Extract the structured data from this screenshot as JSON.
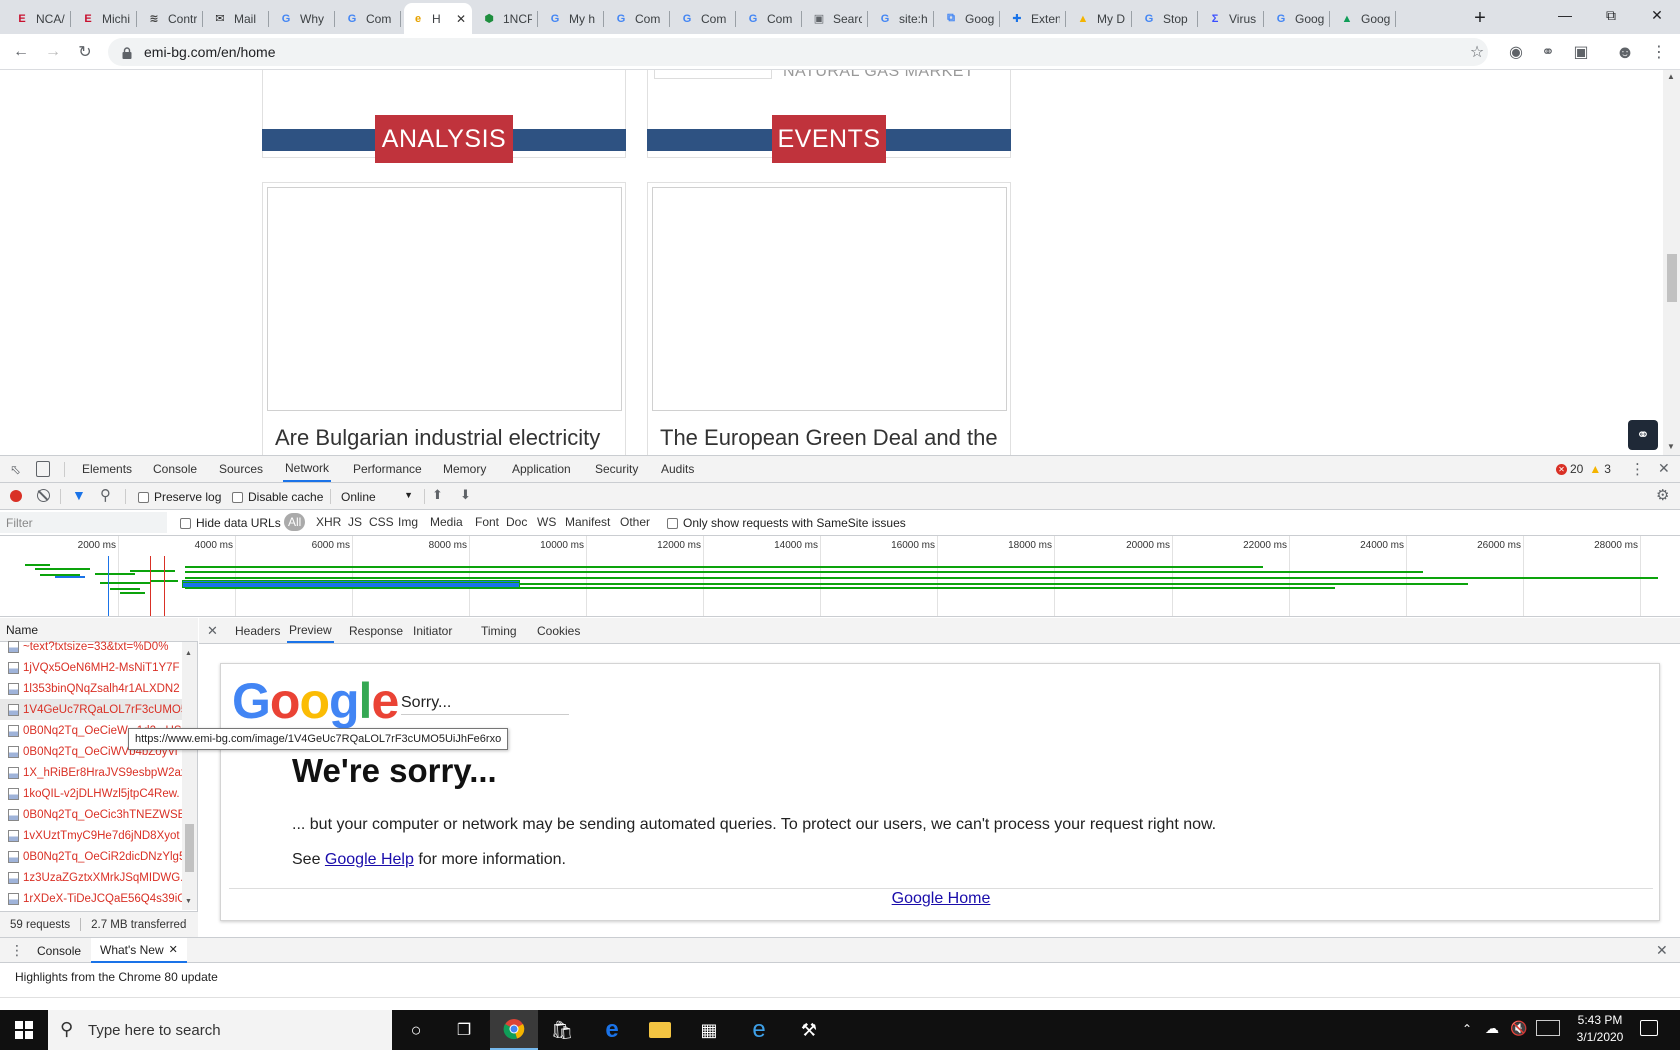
{
  "tabs": [
    {
      "title": "NCA/",
      "fav": "E",
      "color": "#c8102e"
    },
    {
      "title": "Michi",
      "fav": "E",
      "color": "#c8102e"
    },
    {
      "title": "Contr",
      "fav": "≋",
      "color": "#444"
    },
    {
      "title": "Mail",
      "fav": "✉",
      "color": "#222"
    },
    {
      "title": "Why",
      "fav": "G",
      "color": "#4285f4"
    },
    {
      "title": "Com",
      "fav": "G",
      "color": "#4285f4"
    },
    {
      "title": "H",
      "fav": "e",
      "color": "#e6a200",
      "active": true
    },
    {
      "title": "1NCP",
      "fav": "⬢",
      "color": "#1e8e3e"
    },
    {
      "title": "My h",
      "fav": "G",
      "color": "#4285f4"
    },
    {
      "title": "Com",
      "fav": "G",
      "color": "#4285f4"
    },
    {
      "title": "Com",
      "fav": "G",
      "color": "#4285f4"
    },
    {
      "title": "Com",
      "fav": "G",
      "color": "#4285f4"
    },
    {
      "title": "Searc",
      "fav": "▣",
      "color": "#5f6368"
    },
    {
      "title": "site:h",
      "fav": "G",
      "color": "#4285f4"
    },
    {
      "title": "Goog",
      "fav": "⧉",
      "color": "#4285f4"
    },
    {
      "title": "Exten",
      "fav": "✚",
      "color": "#1a73e8"
    },
    {
      "title": "My D",
      "fav": "▲",
      "color": "#f4b400"
    },
    {
      "title": "Stop",
      "fav": "G",
      "color": "#4285f4"
    },
    {
      "title": "Virus",
      "fav": "Σ",
      "color": "#394eff"
    },
    {
      "title": "Goog",
      "fav": "G",
      "color": "#4285f4"
    },
    {
      "title": "Goog",
      "fav": "▲",
      "color": "#0f9d58"
    }
  ],
  "address": {
    "url": "emi-bg.com/en/home"
  },
  "page": {
    "top_card_text": "NATURAL GAS MARKET",
    "analysis_label": "ANALYSIS",
    "events_label": "EVENTS",
    "analysis_title": "Are Bulgarian industrial electricity",
    "events_title": "The European Green Deal and the"
  },
  "devtools": {
    "tabs": [
      "Elements",
      "Console",
      "Sources",
      "Network",
      "Performance",
      "Memory",
      "Application",
      "Security",
      "Audits"
    ],
    "selected_tab": "Network",
    "errors": "20",
    "warnings": "3",
    "preserve_log": "Preserve log",
    "disable_cache": "Disable cache",
    "throttle": "Online",
    "filter_placeholder": "Filter",
    "hide_data_urls": "Hide data URLs",
    "filter_types": [
      "All",
      "XHR",
      "JS",
      "CSS",
      "Img",
      "Media",
      "Font",
      "Doc",
      "WS",
      "Manifest",
      "Other"
    ],
    "samesite": "Only show requests with SameSite issues",
    "ticks": [
      "2000 ms",
      "4000 ms",
      "6000 ms",
      "8000 ms",
      "10000 ms",
      "12000 ms",
      "14000 ms",
      "16000 ms",
      "18000 ms",
      "20000 ms",
      "22000 ms",
      "24000 ms",
      "26000 ms",
      "28000 ms"
    ],
    "name_header": "Name",
    "requests": [
      "~text?txtsize=33&txt=%D0%",
      "1jVQx5OeN6MH2-MsNiT1Y7F",
      "1l353binQNqZsalh4r1ALXDN2",
      "1V4GeUc7RQaLOL7rF3cUMO5",
      "0B0Nq2Tq_OeCieW...1d2...US6",
      "0B0Nq2Tq_OeCiWVb4bZoyVi",
      "1X_hRiBEr8HraJVS9esbpW2ax",
      "1koQIL-v2jDLHWzl5jtpC4Rew.",
      "0B0Nq2Tq_OeCic3hTNEZWSE",
      "1vXUztTmyC9He7d6jND8Xyot",
      "0B0Nq2Tq_OeCiR2dicDNzYlg5",
      "1z3UzaZGztxXMrkJSqMIDWG.",
      "1rXDeX-TiDeJCQaE56Q4s39iG"
    ],
    "status": {
      "requests": "59 requests",
      "transferred": "2.7 MB transferred"
    },
    "detail_tabs": [
      "Headers",
      "Preview",
      "Response",
      "Initiator",
      "Timing",
      "Cookies"
    ],
    "detail_selected": "Preview",
    "tooltip": "https://www.emi-bg.com/image/1V4GeUc7RQaLOL7rF3cUMO5UiJhFe6rxo"
  },
  "preview": {
    "logo": [
      "G",
      "o",
      "o",
      "g",
      "l",
      "e"
    ],
    "logo_colors": [
      "#4285f4",
      "#ea4335",
      "#fbbc05",
      "#4285f4",
      "#34a853",
      "#ea4335"
    ],
    "sorry_small": "Sorry...",
    "heading": "We're sorry...",
    "body": "... but your computer or network may be sending automated queries. To protect our users, we can't process your request right now.",
    "see": "See",
    "help_link": "Google Help",
    "more_info": "for more information.",
    "home_link": "Google Home"
  },
  "drawer": {
    "tabs": [
      "Console",
      "What's New"
    ],
    "selected": "What's New",
    "highlight": "Highlights from the Chrome 80 update"
  },
  "taskbar": {
    "search_placeholder": "Type here to search",
    "time": "5:43 PM",
    "date": "3/1/2020"
  }
}
